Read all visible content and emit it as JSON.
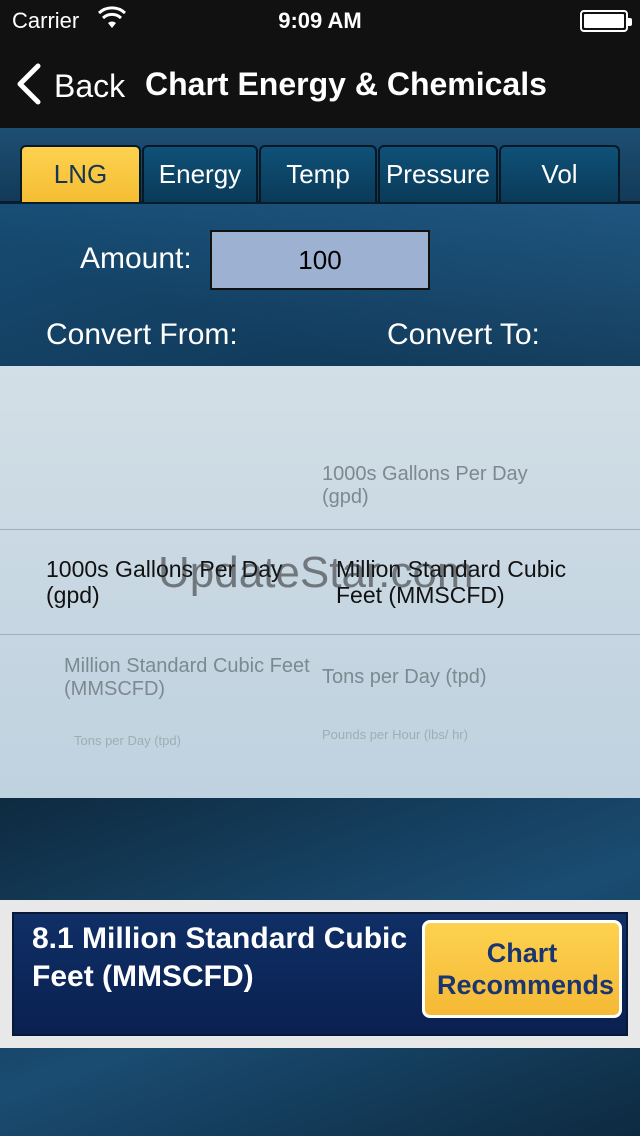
{
  "status_bar": {
    "carrier": "Carrier",
    "time": "9:09 AM",
    "wifi_icon": "wifi-icon",
    "battery_icon": "battery-icon"
  },
  "nav": {
    "back_label": "Back",
    "title": "Chart Energy & Chemicals",
    "back_icon": "chevron-left-icon"
  },
  "tabs": [
    {
      "label": "LNG",
      "active": true
    },
    {
      "label": "Energy",
      "active": false
    },
    {
      "label": "Temp",
      "active": false
    },
    {
      "label": "Pressure",
      "active": false
    },
    {
      "label": "Vol",
      "active": false
    }
  ],
  "form": {
    "amount_label": "Amount:",
    "amount_value": "100",
    "convert_from_label": "Convert From:",
    "convert_to_label": "Convert To:"
  },
  "picker": {
    "from_items": [
      "1000s Gallons Per Day (gpd)",
      "Million Standard Cubic Feet (MMSCFD)",
      "Tons per Day (tpd)"
    ],
    "to_items": [
      "1000s Gallons Per Day (gpd)",
      "Million Standard Cubic Feet (MMSCFD)",
      "Tons per Day (tpd)",
      "Pounds per Hour (lbs/ hr)"
    ],
    "watermark": "UpdateStar.com"
  },
  "result": {
    "text": "8.1 Million Standard Cubic Feet (MMSCFD)",
    "button_label": "Chart Recommends"
  },
  "colors": {
    "accent_yellow": "#f8c63f",
    "result_blue": "#0d2a5e",
    "input_bg": "#9db2d3"
  }
}
